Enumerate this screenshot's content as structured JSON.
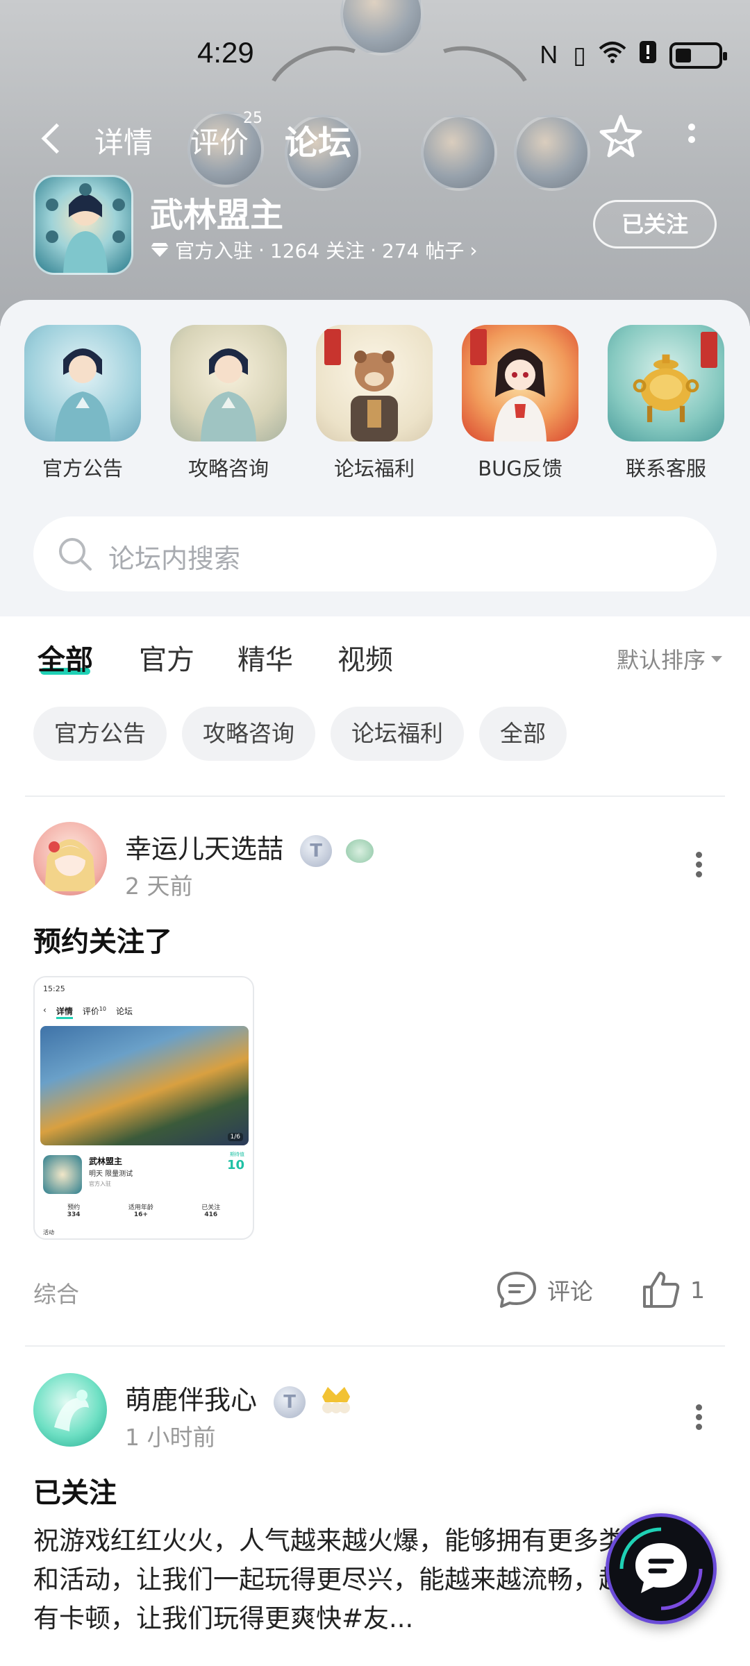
{
  "status_bar": {
    "time": "4:29",
    "icons": [
      "nfc-icon",
      "vibrate-icon",
      "wifi-icon",
      "alert-icon",
      "battery-icon"
    ]
  },
  "nav": {
    "tabs": [
      {
        "label": "详情"
      },
      {
        "label": "评价",
        "badge": "25"
      },
      {
        "label": "论坛",
        "active": true
      }
    ]
  },
  "game": {
    "title": "武林盟主",
    "official": "官方入驻",
    "followers": "1264 关注",
    "posts": "274 帖子",
    "follow_button": "已关注"
  },
  "categories": [
    {
      "label": "官方公告"
    },
    {
      "label": "攻略咨询"
    },
    {
      "label": "论坛福利"
    },
    {
      "label": "BUG反馈"
    },
    {
      "label": "联系客服"
    }
  ],
  "search": {
    "placeholder": "论坛内搜索"
  },
  "filter_tabs": [
    {
      "label": "全部",
      "active": true
    },
    {
      "label": "官方"
    },
    {
      "label": "精华"
    },
    {
      "label": "视频"
    }
  ],
  "sort_label": "默认排序",
  "chips": [
    "官方公告",
    "攻略咨询",
    "论坛福利",
    "全部"
  ],
  "posts": [
    {
      "user": "幸运儿天选喆",
      "badge": "T",
      "time": "2 天前",
      "title": "预约关注了",
      "thumb": {
        "status_time": "15:25",
        "tabs": [
          "详情",
          "评价",
          "论坛"
        ],
        "tab_badge": "10",
        "game_title": "武林盟主",
        "game_sub": "明天 限量测试",
        "official": "官方入驻",
        "page": "1/6",
        "score_label": "期待值",
        "score": "10",
        "stats": [
          {
            "label": "预约",
            "value": "334"
          },
          {
            "label": "适用年龄",
            "value": "16+"
          },
          {
            "label": "已关注",
            "value": "416"
          }
        ],
        "footer": "活动"
      },
      "tag": "综合",
      "comment_label": "评论",
      "likes": "1"
    },
    {
      "user": "萌鹿伴我心",
      "badge": "T",
      "time": "1 小时前",
      "title": "已关注",
      "body": "祝游戏红红火火，人气越来越火爆，能够拥有更多类的玩法和活动，让我们一起玩得更尽兴，能越来越流畅，越来越没有卡顿，让我们玩得更爽快#友..."
    }
  ]
}
